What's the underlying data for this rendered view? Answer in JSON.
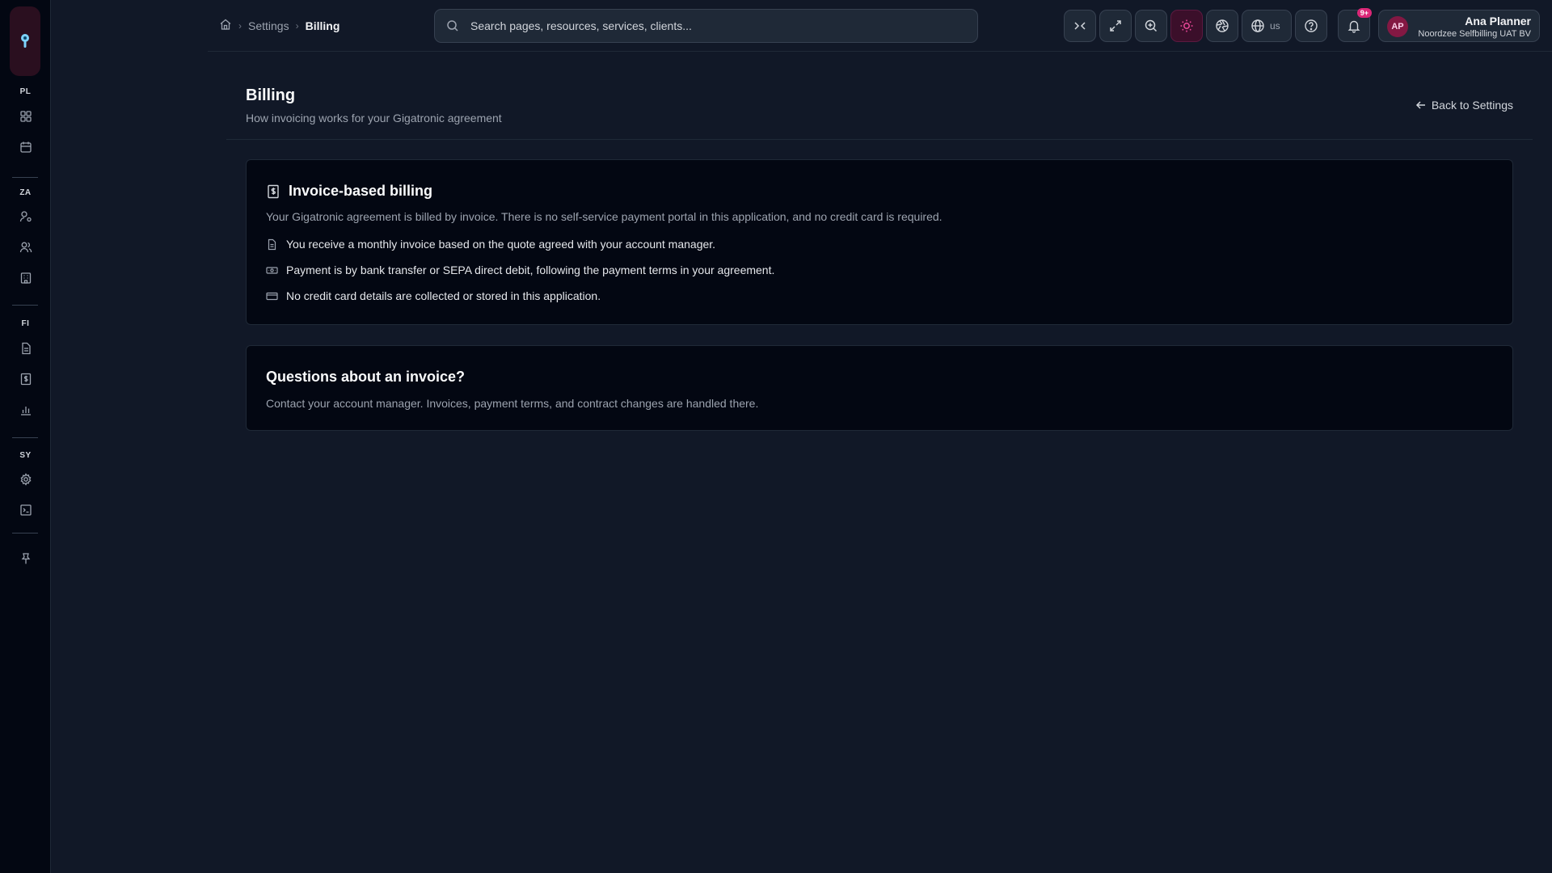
{
  "sidebar": {
    "sections": [
      {
        "label": "PL",
        "items": [
          {
            "icon": "dashboard-icon"
          },
          {
            "icon": "calendar-icon"
          }
        ]
      },
      {
        "label": "ZA",
        "items": [
          {
            "icon": "user-settings-icon"
          },
          {
            "icon": "users-icon"
          },
          {
            "icon": "building-icon"
          }
        ]
      },
      {
        "label": "FI",
        "items": [
          {
            "icon": "document-icon"
          },
          {
            "icon": "invoice-dollar-icon"
          },
          {
            "icon": "bar-chart-icon"
          }
        ]
      },
      {
        "label": "SY",
        "items": [
          {
            "icon": "gear-icon"
          },
          {
            "icon": "terminal-icon"
          }
        ]
      }
    ]
  },
  "breadcrumb": {
    "home_icon": "home-icon",
    "items": [
      "Settings",
      "Billing"
    ]
  },
  "search": {
    "placeholder": "Search pages, resources, services, clients..."
  },
  "toolbar": {
    "language": "us",
    "notifications_badge": "9+",
    "accent_color": "#ec4899"
  },
  "user": {
    "initials": "AP",
    "name": "Ana Planner",
    "org": "Noordzee Selfbilling UAT BV"
  },
  "page": {
    "title": "Billing",
    "subtitle": "How invoicing works for your Gigatronic agreement",
    "back_label": "Back to Settings"
  },
  "card_invoice": {
    "title": "Invoice-based billing",
    "description": "Your Gigatronic agreement is billed by invoice. There is no self-service payment portal in this application, and no credit card is required.",
    "bullets": [
      "You receive a monthly invoice based on the quote agreed with your account manager.",
      "Payment is by bank transfer or SEPA direct debit, following the payment terms in your agreement.",
      "No credit card details are collected or stored in this application."
    ]
  },
  "card_questions": {
    "title": "Questions about an invoice?",
    "description": "Contact your account manager. Invoices, payment terms, and contract changes are handled there."
  }
}
